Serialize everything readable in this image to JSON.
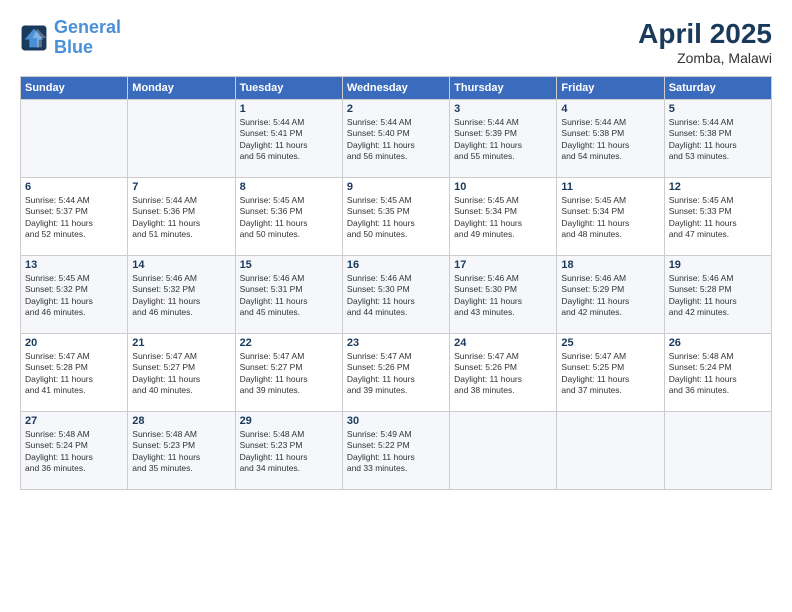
{
  "logo": {
    "line1": "General",
    "line2": "Blue"
  },
  "title": "April 2025",
  "subtitle": "Zomba, Malawi",
  "days_of_week": [
    "Sunday",
    "Monday",
    "Tuesday",
    "Wednesday",
    "Thursday",
    "Friday",
    "Saturday"
  ],
  "weeks": [
    [
      {
        "day": "",
        "content": ""
      },
      {
        "day": "",
        "content": ""
      },
      {
        "day": "1",
        "content": "Sunrise: 5:44 AM\nSunset: 5:41 PM\nDaylight: 11 hours\nand 56 minutes."
      },
      {
        "day": "2",
        "content": "Sunrise: 5:44 AM\nSunset: 5:40 PM\nDaylight: 11 hours\nand 56 minutes."
      },
      {
        "day": "3",
        "content": "Sunrise: 5:44 AM\nSunset: 5:39 PM\nDaylight: 11 hours\nand 55 minutes."
      },
      {
        "day": "4",
        "content": "Sunrise: 5:44 AM\nSunset: 5:38 PM\nDaylight: 11 hours\nand 54 minutes."
      },
      {
        "day": "5",
        "content": "Sunrise: 5:44 AM\nSunset: 5:38 PM\nDaylight: 11 hours\nand 53 minutes."
      }
    ],
    [
      {
        "day": "6",
        "content": "Sunrise: 5:44 AM\nSunset: 5:37 PM\nDaylight: 11 hours\nand 52 minutes."
      },
      {
        "day": "7",
        "content": "Sunrise: 5:44 AM\nSunset: 5:36 PM\nDaylight: 11 hours\nand 51 minutes."
      },
      {
        "day": "8",
        "content": "Sunrise: 5:45 AM\nSunset: 5:36 PM\nDaylight: 11 hours\nand 50 minutes."
      },
      {
        "day": "9",
        "content": "Sunrise: 5:45 AM\nSunset: 5:35 PM\nDaylight: 11 hours\nand 50 minutes."
      },
      {
        "day": "10",
        "content": "Sunrise: 5:45 AM\nSunset: 5:34 PM\nDaylight: 11 hours\nand 49 minutes."
      },
      {
        "day": "11",
        "content": "Sunrise: 5:45 AM\nSunset: 5:34 PM\nDaylight: 11 hours\nand 48 minutes."
      },
      {
        "day": "12",
        "content": "Sunrise: 5:45 AM\nSunset: 5:33 PM\nDaylight: 11 hours\nand 47 minutes."
      }
    ],
    [
      {
        "day": "13",
        "content": "Sunrise: 5:45 AM\nSunset: 5:32 PM\nDaylight: 11 hours\nand 46 minutes."
      },
      {
        "day": "14",
        "content": "Sunrise: 5:46 AM\nSunset: 5:32 PM\nDaylight: 11 hours\nand 46 minutes."
      },
      {
        "day": "15",
        "content": "Sunrise: 5:46 AM\nSunset: 5:31 PM\nDaylight: 11 hours\nand 45 minutes."
      },
      {
        "day": "16",
        "content": "Sunrise: 5:46 AM\nSunset: 5:30 PM\nDaylight: 11 hours\nand 44 minutes."
      },
      {
        "day": "17",
        "content": "Sunrise: 5:46 AM\nSunset: 5:30 PM\nDaylight: 11 hours\nand 43 minutes."
      },
      {
        "day": "18",
        "content": "Sunrise: 5:46 AM\nSunset: 5:29 PM\nDaylight: 11 hours\nand 42 minutes."
      },
      {
        "day": "19",
        "content": "Sunrise: 5:46 AM\nSunset: 5:28 PM\nDaylight: 11 hours\nand 42 minutes."
      }
    ],
    [
      {
        "day": "20",
        "content": "Sunrise: 5:47 AM\nSunset: 5:28 PM\nDaylight: 11 hours\nand 41 minutes."
      },
      {
        "day": "21",
        "content": "Sunrise: 5:47 AM\nSunset: 5:27 PM\nDaylight: 11 hours\nand 40 minutes."
      },
      {
        "day": "22",
        "content": "Sunrise: 5:47 AM\nSunset: 5:27 PM\nDaylight: 11 hours\nand 39 minutes."
      },
      {
        "day": "23",
        "content": "Sunrise: 5:47 AM\nSunset: 5:26 PM\nDaylight: 11 hours\nand 39 minutes."
      },
      {
        "day": "24",
        "content": "Sunrise: 5:47 AM\nSunset: 5:26 PM\nDaylight: 11 hours\nand 38 minutes."
      },
      {
        "day": "25",
        "content": "Sunrise: 5:47 AM\nSunset: 5:25 PM\nDaylight: 11 hours\nand 37 minutes."
      },
      {
        "day": "26",
        "content": "Sunrise: 5:48 AM\nSunset: 5:24 PM\nDaylight: 11 hours\nand 36 minutes."
      }
    ],
    [
      {
        "day": "27",
        "content": "Sunrise: 5:48 AM\nSunset: 5:24 PM\nDaylight: 11 hours\nand 36 minutes."
      },
      {
        "day": "28",
        "content": "Sunrise: 5:48 AM\nSunset: 5:23 PM\nDaylight: 11 hours\nand 35 minutes."
      },
      {
        "day": "29",
        "content": "Sunrise: 5:48 AM\nSunset: 5:23 PM\nDaylight: 11 hours\nand 34 minutes."
      },
      {
        "day": "30",
        "content": "Sunrise: 5:49 AM\nSunset: 5:22 PM\nDaylight: 11 hours\nand 33 minutes."
      },
      {
        "day": "",
        "content": ""
      },
      {
        "day": "",
        "content": ""
      },
      {
        "day": "",
        "content": ""
      }
    ]
  ]
}
